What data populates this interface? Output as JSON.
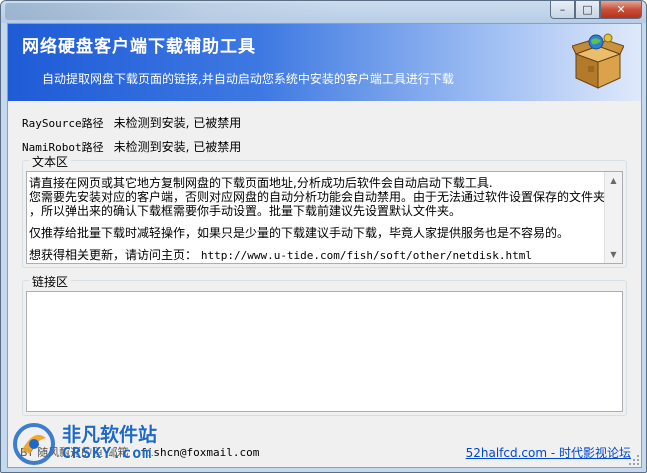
{
  "window": {
    "buttons": {
      "minimize": "–",
      "maximize": "□",
      "close": "✕"
    }
  },
  "banner": {
    "title": "网络硬盘客户端下载辅助工具",
    "subtitle": "自动提取网盘下载页面的链接,并自动启动您系统中安装的客户端工具进行下载",
    "logo_icon": "package-box-icon"
  },
  "paths": [
    {
      "label": "RaySource路径",
      "status": "未检测到安装, 已被禁用"
    },
    {
      "label": "NamiRobot路径",
      "status": "未检测到安装, 已被禁用"
    }
  ],
  "text_group": {
    "title": "文本区",
    "lines": [
      "请直接在网页或其它地方复制网盘的下载页面地址,分析成功后软件会自动启动下载工具.",
      "您需要先安装对应的客户端，否则对应网盘的自动分析功能会自动禁用。由于无法通过软件设置保存的文件夹",
      "，所以弹出来的确认下载框需要你手动设置。批量下载前建议先设置默认文件夹。",
      "仅推荐给批量下载时减轻操作，如果只是少量的下载建议手动下载，毕竟人家提供服务也是不容易的。",
      "想获得相关更新，请访问主页："
    ],
    "url": "http://www.u-tide.com/fish/soft/other/netdisk.html"
  },
  "link_group": {
    "title": "链接区",
    "content": ""
  },
  "footer": {
    "author_prefix": "BY 随风飘逝的鱼 邮箱",
    "email": "fishcn@foxmail.com",
    "link": "52halfcd.com - 时代影视论坛"
  },
  "watermark": {
    "name": "非凡软件站",
    "sub": "CRSKY.com"
  }
}
